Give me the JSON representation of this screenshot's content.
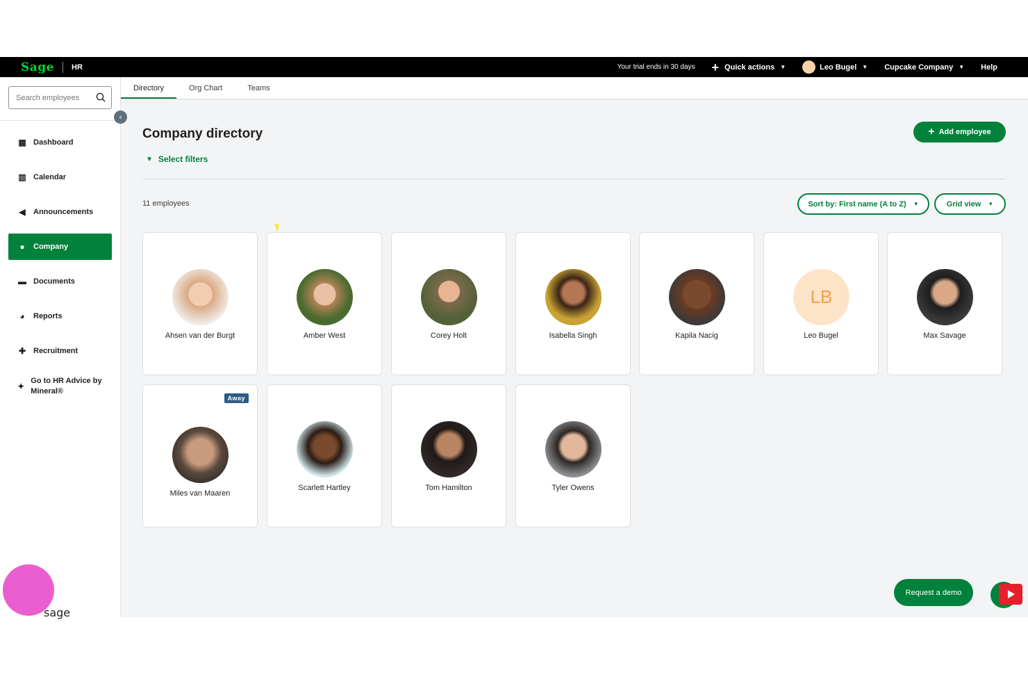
{
  "topbar": {
    "logo": "Sage",
    "product": "HR",
    "trial": "Your trial ends in 30 days",
    "quick_actions": "Quick actions",
    "user": "Leo Bugel",
    "company": "Cupcake Company",
    "help": "Help"
  },
  "search": {
    "placeholder": "Search employees"
  },
  "sidebar": {
    "items": [
      {
        "label": "Dashboard",
        "icon": "dashboard-icon"
      },
      {
        "label": "Calendar",
        "icon": "calendar-icon"
      },
      {
        "label": "Announcements",
        "icon": "megaphone-icon"
      },
      {
        "label": "Company",
        "icon": "people-icon",
        "active": true
      },
      {
        "label": "Documents",
        "icon": "folder-icon"
      },
      {
        "label": "Reports",
        "icon": "pie-chart-icon"
      },
      {
        "label": "Recruitment",
        "icon": "add-user-icon"
      },
      {
        "label": "Go to HR Advice by Mineral®",
        "icon": "handshake-icon"
      }
    ]
  },
  "tabs": [
    "Directory",
    "Org Chart",
    "Teams"
  ],
  "main": {
    "title": "Company directory",
    "filters": "Select filters",
    "add_employee": "Add employee",
    "count": "11 employees",
    "sort": "Sort by: First name (A to Z)",
    "view": "Grid view"
  },
  "employees": [
    {
      "name": "Ahsen van der Burgt",
      "color": "#d9a882"
    },
    {
      "name": "Amber West",
      "color": "#4a6b2f"
    },
    {
      "name": "Corey Holt",
      "color": "#55613a"
    },
    {
      "name": "Isabella Singh",
      "color": "#c8a334"
    },
    {
      "name": "Kapila Nacig",
      "color": "#6b3b22"
    },
    {
      "name": "Leo Bugel",
      "initials": "LB"
    },
    {
      "name": "Max Savage",
      "color": "#3b3b3b"
    },
    {
      "name": "Miles van Maaren",
      "color": "#5b4a3d",
      "badge": "Away"
    },
    {
      "name": "Scarlett Hartley",
      "color": "#cfe6ea"
    },
    {
      "name": "Tom Hamilton",
      "color": "#2f2a29"
    },
    {
      "name": "Tyler Owens",
      "color": "#8d8f93"
    }
  ],
  "footer": {
    "request_demo": "Request a demo",
    "watermark_text": "sage"
  }
}
